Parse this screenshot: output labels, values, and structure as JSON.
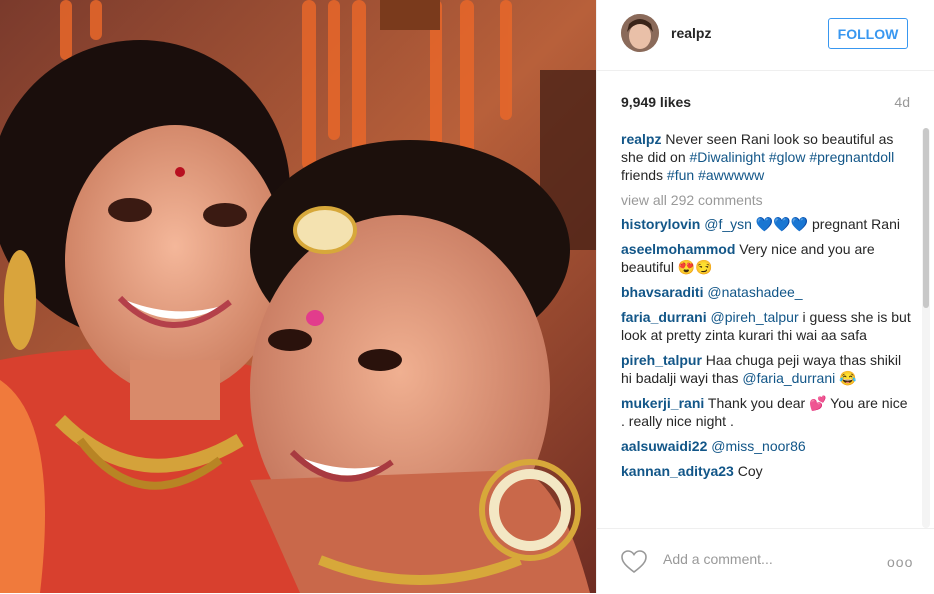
{
  "post": {
    "username": "realpz",
    "follow_label": "FOLLOW",
    "likes": "9,949 likes",
    "time_ago": "4d"
  },
  "caption": {
    "user": "realpz",
    "t1": "Never seen Rani look so beautiful as she did on ",
    "tag1": "#Diwalinight",
    "tag2": "#glow",
    "tag3": "#pregnantdoll",
    "t2": " friends ",
    "tag4": "#fun",
    "tag5": "#awwwww"
  },
  "view_all": "view all 292 comments",
  "comments": [
    {
      "user": "historylovin",
      "mention": "@f_ysn",
      "emoji": "💙💙💙",
      "text": "pregnant Rani"
    },
    {
      "user": "aseelmohammod",
      "text": "Very nice and you are beautiful",
      "emoji": "😍😏"
    },
    {
      "user": "bhavsaraditi",
      "mention": "@natashadee_"
    },
    {
      "user": "faria_durrani",
      "mention": "@pireh_talpur",
      "text": "i guess she is but look at pretty zinta kurari thi wai aa safa"
    },
    {
      "user": "pireh_talpur",
      "text": "Haa chuga peji waya thas shikil hi badalji wayi thas",
      "mention": "@faria_durrani",
      "emoji": "😂"
    },
    {
      "user": "mukerji_rani",
      "text": "Thank you dear",
      "emoji": "💕",
      "text2": "You are nice . really nice night ."
    },
    {
      "user": "aalsuwaidi22",
      "mention": "@miss_noor86"
    },
    {
      "user": "kannan_aditya23",
      "text": "Coy"
    }
  ],
  "footer": {
    "placeholder": "Add a comment...",
    "more": "ooo"
  },
  "icons": {
    "like": "heart-outline-icon",
    "more": "more-options-icon"
  },
  "colors": {
    "link": "#125688",
    "follow": "#3897f0",
    "muted": "#999999"
  }
}
